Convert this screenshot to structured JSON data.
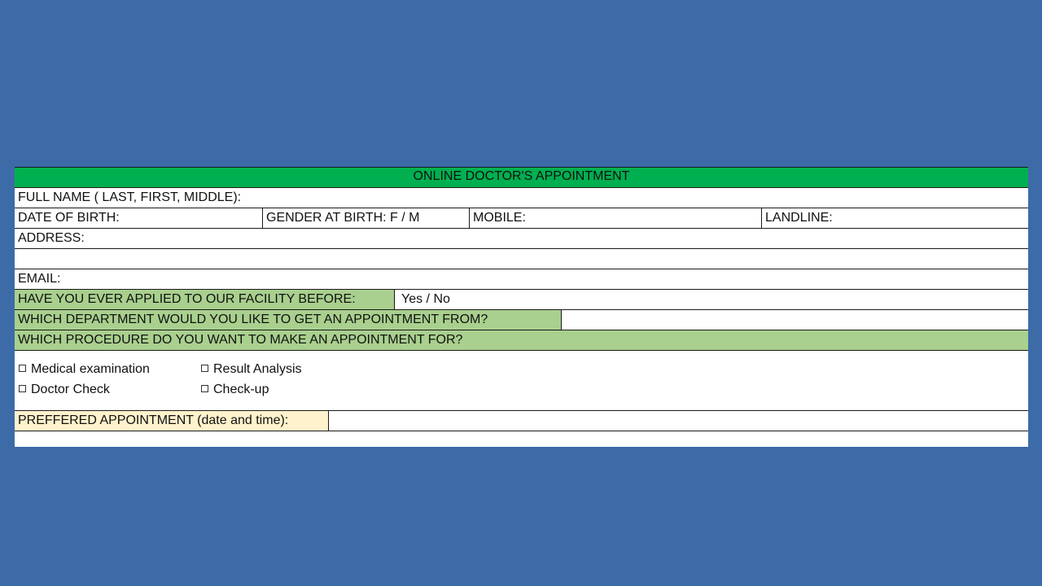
{
  "form": {
    "title": "ONLINE DOCTOR'S APPOINTMENT",
    "full_name_label": "FULL NAME ( LAST, FIRST, MIDDLE):",
    "dob_label": "DATE OF BIRTH:",
    "gender_label": "GENDER AT BIRTH:  F / M",
    "mobile_label": "MOBILE:",
    "landline_label": "LANDLINE:",
    "address_label": "ADDRESS:",
    "email_label": "EMAIL:",
    "applied_before_label": "HAVE YOU EVER APPLIED TO OUR FACILITY BEFORE:",
    "applied_before_value": "Yes / No",
    "department_label": "WHICH DEPARTMENT WOULD YOU LIKE TO GET AN APPOINTMENT FROM?",
    "procedure_label": "WHICH PROCEDURE DO YOU WANT TO MAKE AN APPOINTMENT FOR?",
    "procedures": [
      "Medical examination",
      "Result Analysis",
      "Doctor Check",
      "Check-up"
    ],
    "preferred_label": "PREFFERED APPOINTMENT (date and time):"
  },
  "colors": {
    "background": "#3c6ba8",
    "title_bar": "#00b050",
    "question_fill": "#a9d08e",
    "preferred_fill": "#fff2cc"
  }
}
